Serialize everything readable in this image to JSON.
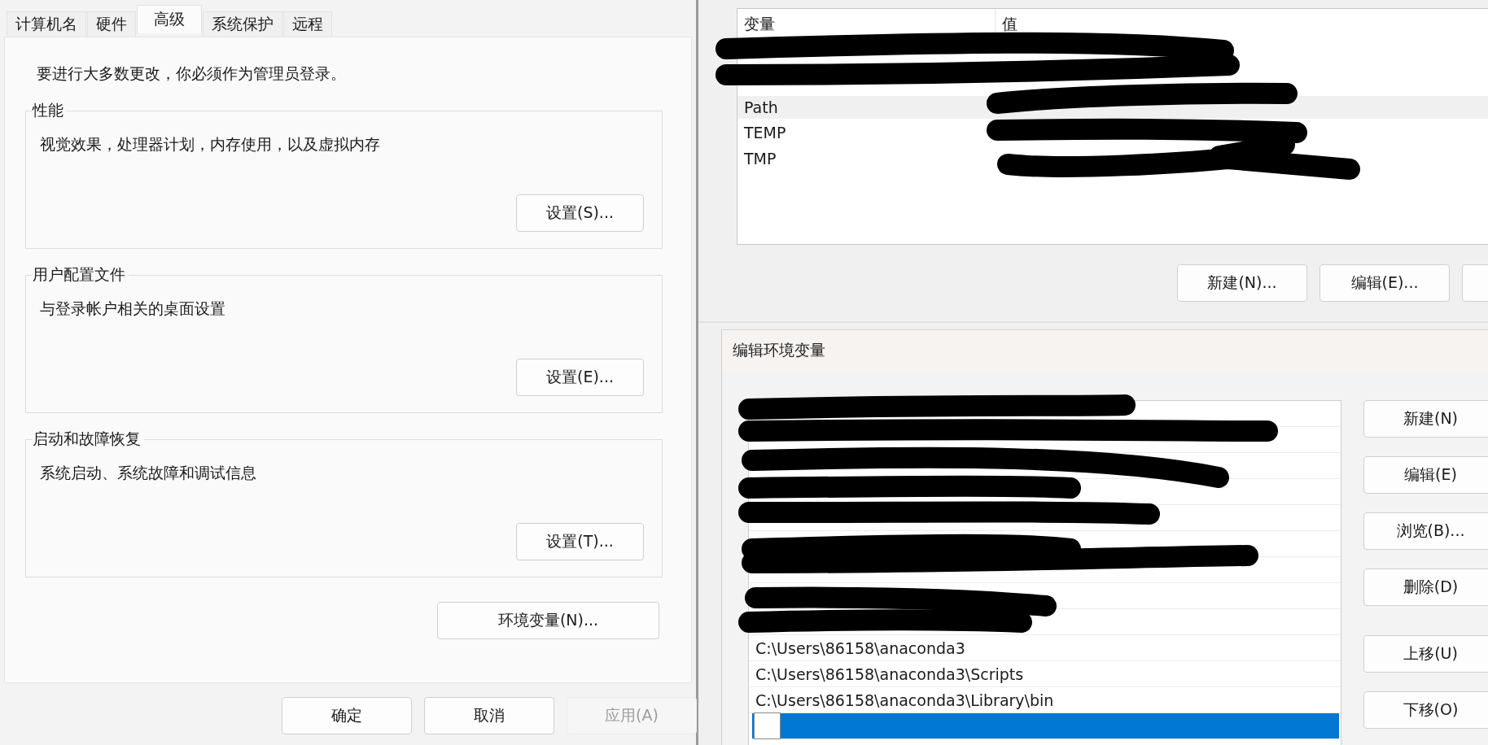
{
  "system_properties": {
    "tabs": [
      {
        "label": "计算机名",
        "selected": false
      },
      {
        "label": "硬件",
        "selected": false
      },
      {
        "label": "高级",
        "selected": true
      },
      {
        "label": "系统保护",
        "selected": false
      },
      {
        "label": "远程",
        "selected": false
      }
    ],
    "notice": "要进行大多数更改，你必须作为管理员登录。",
    "groups": [
      {
        "title": "性能",
        "description": "视觉效果，处理器计划，内存使用，以及虚拟内存",
        "button": "设置(S)..."
      },
      {
        "title": "用户配置文件",
        "description": "与登录帐户相关的桌面设置",
        "button": "设置(E)..."
      },
      {
        "title": "启动和故障恢复",
        "description": "系统启动、系统故障和调试信息",
        "button": "设置(T)..."
      }
    ],
    "env_button": "环境变量(N)...",
    "footer_buttons": [
      {
        "label": "确定",
        "disabled": false
      },
      {
        "label": "取消",
        "disabled": false
      },
      {
        "label": "应用(A)",
        "disabled": true
      }
    ]
  },
  "user_variables": {
    "columns": [
      "变量",
      "值"
    ],
    "rows": [
      {
        "kind": "redacted",
        "selected": false
      },
      {
        "kind": "redacted",
        "selected": false
      },
      {
        "kind": "entry",
        "name": "Path",
        "selected": true
      },
      {
        "kind": "entry",
        "name": "TEMP",
        "selected": false
      },
      {
        "kind": "entry",
        "name": "TMP",
        "selected": false
      }
    ],
    "buttons": [
      "新建(N)...",
      "编辑(E)..."
    ]
  },
  "edit_dialog": {
    "title": "编辑环境变量",
    "rows": [
      {
        "kind": "redacted",
        "selected": false
      },
      {
        "kind": "redacted",
        "selected": false
      },
      {
        "kind": "redacted",
        "selected": false
      },
      {
        "kind": "redacted",
        "selected": false
      },
      {
        "kind": "redacted",
        "selected": false
      },
      {
        "kind": "redacted",
        "selected": false
      },
      {
        "kind": "redacted",
        "selected": false
      },
      {
        "kind": "redacted",
        "selected": false
      },
      {
        "kind": "redacted",
        "selected": false
      },
      {
        "kind": "path",
        "text": "C:\\Users\\86158\\anaconda3",
        "selected": false
      },
      {
        "kind": "path",
        "text": "C:\\Users\\86158\\anaconda3\\Scripts",
        "selected": false
      },
      {
        "kind": "path",
        "text": "C:\\Users\\86158\\anaconda3\\Library\\bin",
        "selected": false
      },
      {
        "kind": "editing",
        "selected": true
      }
    ],
    "buttons": [
      "新建(N)",
      "编辑(E)",
      "浏览(B)...",
      "删除(D)"
    ],
    "move_buttons": [
      "上移(U)",
      "下移(O)"
    ]
  }
}
